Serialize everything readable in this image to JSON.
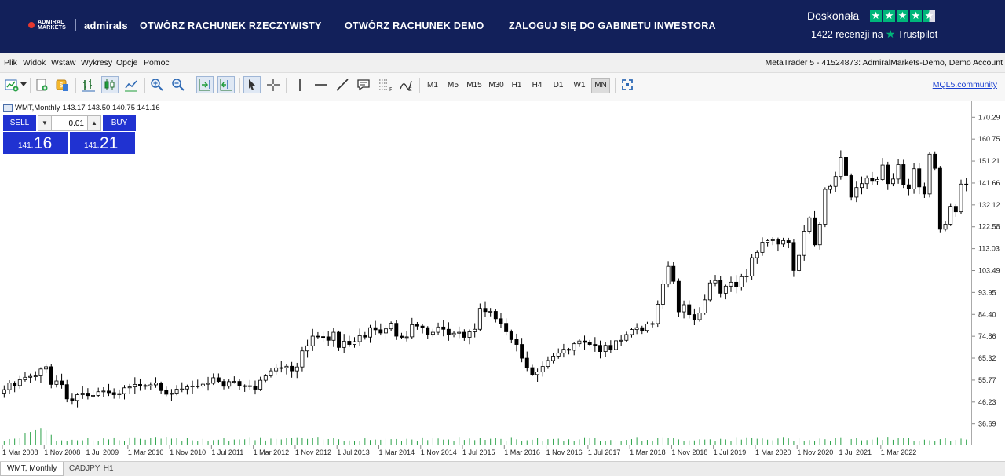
{
  "banner": {
    "logo_small": "ADMIRAL MARKETS",
    "logo_word": "admirals",
    "nav": [
      "OTWÓRZ RACHUNEK RZECZYWISTY",
      "OTWÓRZ RACHUNEK DEMO",
      "ZALOGUJ SIĘ DO GABINETU INWESTORA"
    ],
    "rating_title": "Doskonała",
    "reviews_text": "1422 recenzji na",
    "trustpilot": "Trustpilot",
    "stars": 4.5,
    "accent_color": "#00b67a",
    "background_color": "#12205a"
  },
  "menu": {
    "items": [
      "Plik",
      "Widok",
      "Wstaw",
      "Wykresy",
      "Opcje",
      "Pomoc"
    ],
    "account_info": "MetaTrader 5 - 41524873: AdmiralMarkets-Demo, Demo Account"
  },
  "toolbar": {
    "icons": [
      "new-chart-icon",
      "dropdown-arrow-icon",
      "new-order-icon",
      "algo-trading-icon",
      "bar-chart-icon",
      "candlestick-icon",
      "line-chart-icon",
      "zoom-in-icon",
      "zoom-out-icon",
      "autoscroll-icon",
      "chart-shift-icon",
      "cursor-icon",
      "crosshair-icon",
      "vertical-line-icon",
      "horizontal-line-icon",
      "trendline-icon",
      "text-label-icon",
      "fibonacci-icon",
      "indicators-icon",
      "fullscreen-icon"
    ],
    "timeframes": [
      "M1",
      "M5",
      "M15",
      "M30",
      "H1",
      "H4",
      "D1",
      "W1",
      "MN"
    ],
    "active_timeframe": "MN",
    "link": "MQL5.community"
  },
  "chart_header": {
    "symbol": "WMT,Monthly",
    "ohlc": "143.17 143.50 140.75 141.16"
  },
  "trade_panel": {
    "sell_label": "SELL",
    "buy_label": "BUY",
    "lot": "0.01",
    "sell_price_small": "141.",
    "sell_price_big": "16",
    "buy_price_small": "141.",
    "buy_price_big": "21",
    "button_color": "#2032d1"
  },
  "chart_data": {
    "type": "candlestick",
    "symbol": "WMT",
    "timeframe": "Monthly",
    "y_ticks": [
      "170.29",
      "160.75",
      "151.21",
      "141.66",
      "132.12",
      "122.58",
      "113.03",
      "103.49",
      "93.95",
      "84.40",
      "74.86",
      "65.32",
      "55.77",
      "46.23",
      "36.69"
    ],
    "x_ticks": [
      "1 Mar 2008",
      "1 Nov 2008",
      "1 Jul 2009",
      "1 Mar 2010",
      "1 Nov 2010",
      "1 Jul 2011",
      "1 Mar 2012",
      "1 Nov 2012",
      "1 Jul 2013",
      "1 Mar 2014",
      "1 Nov 2014",
      "1 Jul 2015",
      "1 Mar 2016",
      "1 Nov 2016",
      "1 Jul 2017",
      "1 Mar 2018",
      "1 Nov 2018",
      "1 Jul 2019",
      "1 Mar 2020",
      "1 Nov 2020",
      "1 Jul 2021",
      "1 Mar 2022"
    ],
    "ylim": [
      33.5,
      174.5
    ],
    "closes": [
      51.6,
      54.5,
      53.4,
      55.9,
      57.0,
      57.4,
      57.6,
      60.6,
      61.6,
      53.9,
      55.4,
      53.8,
      47.6,
      46.9,
      49.4,
      50.1,
      49.0,
      49.1,
      50.7,
      51.0,
      50.3,
      49.4,
      49.9,
      52.4,
      52.8,
      53.9,
      53.4,
      53.2,
      53.7,
      54.5,
      51.2,
      49.6,
      50.1,
      51.8,
      51.9,
      52.8,
      53.2,
      53.2,
      54.0,
      54.4,
      56.8,
      55.2,
      53.1,
      55.1,
      55.2,
      53.2,
      53.3,
      53.1,
      51.8,
      55.7,
      57.6,
      59.8,
      61.1,
      61.2,
      61.8,
      59.8,
      61.5,
      68.5,
      70.7,
      74.9,
      74.7,
      74.6,
      73.1,
      76.6,
      70.0,
      72.7,
      71.3,
      72.5,
      75.1,
      74.5,
      78.6,
      77.7,
      76.3,
      78.1,
      80.5,
      74.9,
      74.4,
      74.6,
      79.9,
      79.3,
      78.6,
      75.7,
      76.6,
      78.9,
      77.9,
      75.6,
      76.2,
      76.6,
      74.4,
      76.8,
      77.9,
      87.0,
      85.6,
      85.7,
      82.5,
      80.5,
      76.8,
      73.4,
      71.3,
      65.3,
      61.2,
      58.2,
      59.3,
      61.7,
      64.3,
      66.2,
      67.5,
      69.2,
      68.8,
      71.6,
      72.8,
      72.2,
      71.3,
      70.9,
      68.2,
      70.9,
      69.1,
      72.9,
      73.1,
      75.6,
      77.8,
      78.6,
      77.4,
      80.2,
      80.4,
      88.8,
      97.6,
      105.3,
      98.8,
      85.5,
      88.6,
      84.3,
      82.1,
      85.0,
      90.7,
      98.1,
      99.1,
      93.6,
      96.7,
      98.4,
      96.3,
      100.8,
      101.1,
      109.1,
      111.4,
      115.8,
      116.5,
      117.2,
      115.0,
      116.5,
      115.7,
      103.5,
      110.1,
      120.6,
      126.5,
      114.7,
      123.7,
      138.9,
      140.2,
      144.5,
      152.8,
      144.9,
      135.5,
      139.7,
      141.4,
      143.8,
      142.4,
      143.2,
      149.5,
      141.4,
      143.4,
      149.7,
      140.9,
      139.1,
      147.9,
      140.0,
      136.9,
      154.2,
      148.1,
      121.5,
      123.7,
      131.5,
      129.1,
      141.2,
      141.16
    ]
  },
  "tabs": {
    "active": "WMT, Monthly",
    "other": "CADJPY, H1"
  }
}
